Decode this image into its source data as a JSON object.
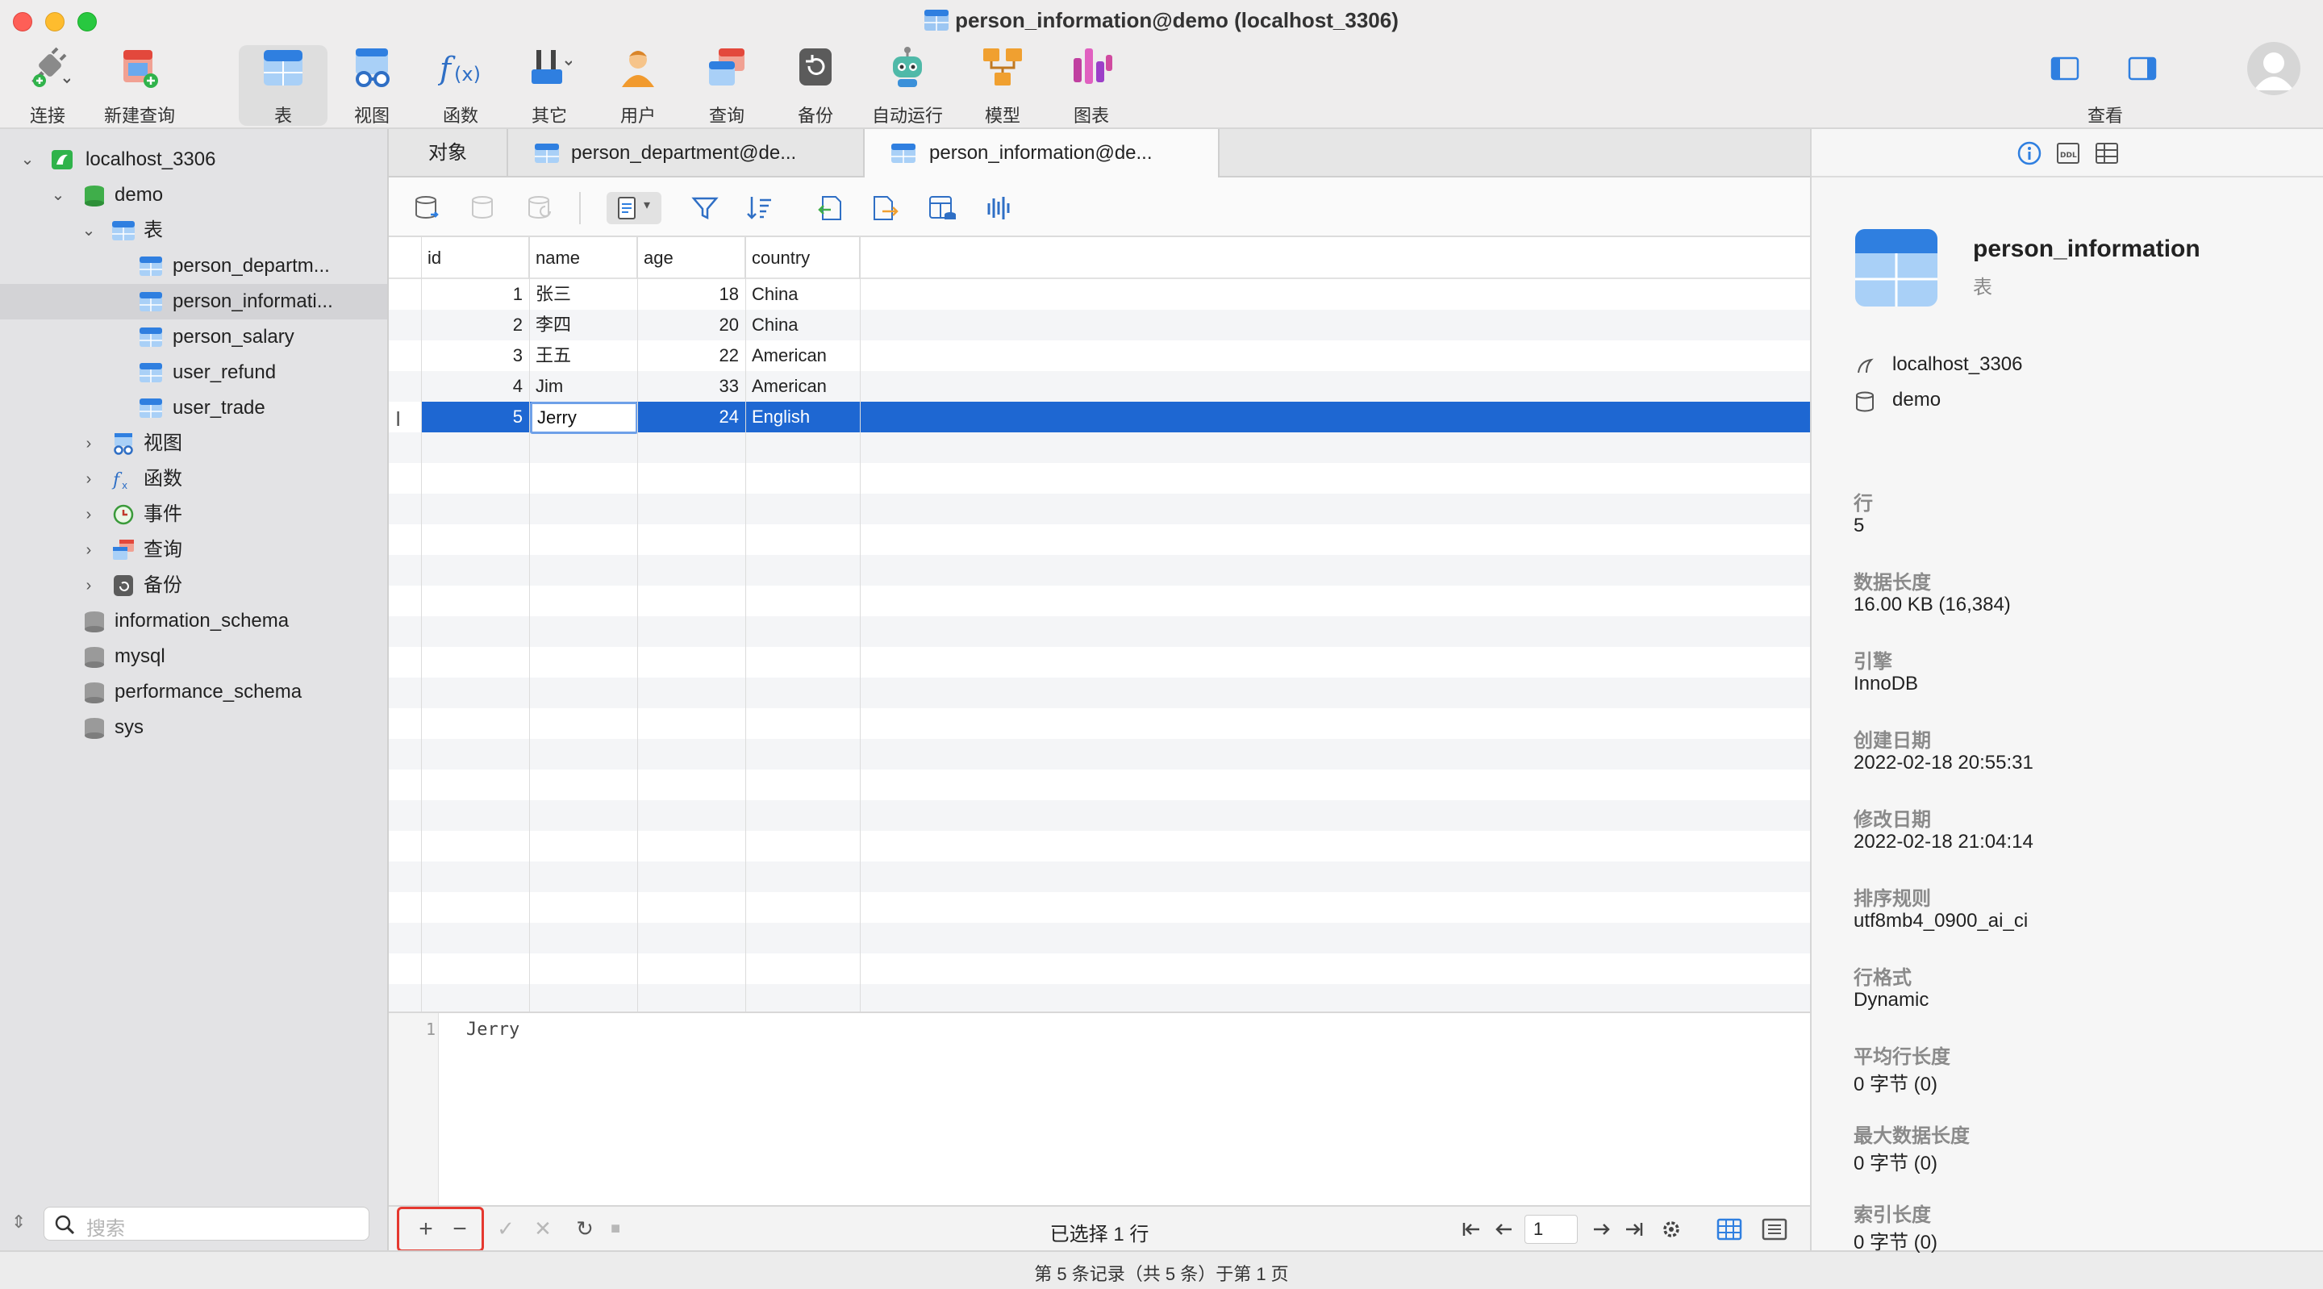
{
  "window": {
    "title": "person_information@demo (localhost_3306)"
  },
  "toolbar": {
    "items": [
      {
        "label": "连接",
        "icon": "connection-plug-icon"
      },
      {
        "label": "新建查询",
        "icon": "new-query-icon"
      },
      {
        "label": "表",
        "icon": "table-icon",
        "active": true
      },
      {
        "label": "视图",
        "icon": "view-glasses-icon"
      },
      {
        "label": "函数",
        "icon": "function-fx-icon"
      },
      {
        "label": "其它",
        "icon": "tools-icon"
      },
      {
        "label": "用户",
        "icon": "user-icon"
      },
      {
        "label": "查询",
        "icon": "query-icon"
      },
      {
        "label": "备份",
        "icon": "backup-icon"
      },
      {
        "label": "自动运行",
        "icon": "robot-icon"
      },
      {
        "label": "模型",
        "icon": "model-icon"
      },
      {
        "label": "图表",
        "icon": "chart-icon"
      }
    ],
    "view_label": "查看"
  },
  "sidebar": {
    "connection": "localhost_3306",
    "database": "demo",
    "tables_group": "表",
    "tables": [
      "person_departm...",
      "person_informati...",
      "person_salary",
      "user_refund",
      "user_trade"
    ],
    "selected_table_index": 1,
    "groups": [
      "视图",
      "函数",
      "事件",
      "查询",
      "备份"
    ],
    "other_databases": [
      "information_schema",
      "mysql",
      "performance_schema",
      "sys"
    ],
    "search_placeholder": "搜索"
  },
  "tabs": {
    "objects": "对象",
    "tab1": "person_department@de...",
    "tab2": "person_information@de..."
  },
  "grid": {
    "columns": [
      "id",
      "name",
      "age",
      "country"
    ],
    "rows": [
      [
        "1",
        "张三",
        "18",
        "China"
      ],
      [
        "2",
        "李四",
        "20",
        "China"
      ],
      [
        "3",
        "王五",
        "22",
        "American"
      ],
      [
        "4",
        "Jim",
        "33",
        "American"
      ],
      [
        "5",
        "Jerry",
        "24",
        "English"
      ]
    ],
    "selected_row": 4,
    "editing_value": "Jerry"
  },
  "editor": {
    "line_number": "1",
    "text": "Jerry"
  },
  "bottom": {
    "add": "+",
    "remove": "−",
    "apply": "✓",
    "discard": "✕",
    "refresh": "↻",
    "stop": "■",
    "selection": "已选择 1 行",
    "page": "1"
  },
  "status": {
    "text": "第 5 条记录（共 5 条）于第 1 页"
  },
  "info": {
    "name": "person_information",
    "type": "表",
    "connection": "localhost_3306",
    "database": "demo",
    "props": [
      {
        "k": "行",
        "v": "5"
      },
      {
        "k": "数据长度",
        "v": "16.00 KB (16,384)"
      },
      {
        "k": "引擎",
        "v": "InnoDB"
      },
      {
        "k": "创建日期",
        "v": "2022-02-18 20:55:31"
      },
      {
        "k": "修改日期",
        "v": "2022-02-18 21:04:14"
      },
      {
        "k": "排序规则",
        "v": "utf8mb4_0900_ai_ci"
      },
      {
        "k": "行格式",
        "v": "Dynamic"
      },
      {
        "k": "平均行长度",
        "v": "0 字节 (0)"
      },
      {
        "k": "最大数据长度",
        "v": "0 字节 (0)"
      },
      {
        "k": "索引长度",
        "v": "0 字节 (0)"
      }
    ]
  },
  "colors": {
    "accent": "#1e67d2",
    "highlight": "#e5382f"
  }
}
